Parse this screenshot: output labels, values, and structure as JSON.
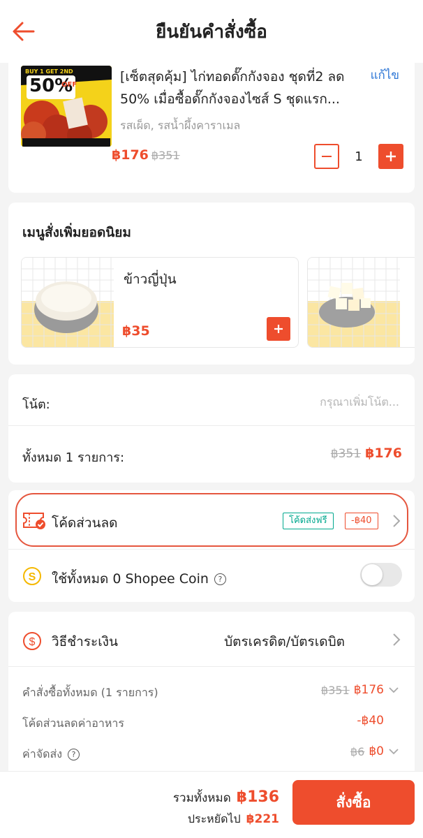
{
  "header": {
    "title": "ยืนยันคำสั่งซื้อ",
    "back_icon": "arrow-left-icon"
  },
  "product": {
    "title": "[เซ็ตสุดคุ้ม] ไก่ทอดดั๊กกังจอง ชุดที่2 ลด 50% เมื่อซื้อดั๊กกังจองไซส์ S ชุดแรก...",
    "edit_label": "แก้ไข",
    "variant": "รสเผ็ด, รสน้ำผึ้งคาราเมล",
    "price": "฿176",
    "original_price": "฿351",
    "quantity": "1",
    "image_badge": {
      "line1": "BUY 1 GET 2ND",
      "line2": "50%",
      "line3": "OFF"
    }
  },
  "popular": {
    "title": "เมนูสั่งเพิ่มยอดนิยม",
    "items": [
      {
        "name": "ข้าวญี่ปุ่น",
        "price": "฿35"
      }
    ]
  },
  "note": {
    "label": "โน้ต:",
    "placeholder": "กรุณาเพิ่มโน้ต..."
  },
  "subtotal": {
    "label": "ทั้งหมด 1 รายการ:",
    "original": "฿351",
    "total": "฿176"
  },
  "voucher": {
    "label": "โค้ดส่วนลด",
    "free_shipping_tag": "โค้ดส่งฟรี",
    "discount_tag": "-฿40"
  },
  "coin": {
    "label": "ใช้ทั้งหมด 0 Shopee Coin",
    "enabled": false
  },
  "payment": {
    "label": "วิธีชำระเงิน",
    "value": "บัตรเครดิต/บัตรเดบิต"
  },
  "summary": {
    "order_label": "คำสั่งซื้อทั้งหมด (1 รายการ)",
    "order_original": "฿351",
    "order_total": "฿176",
    "discount_label": "โค้ดส่วนลดค่าอาหาร",
    "discount_value": "-฿40",
    "shipping_label": "ค่าจัดส่ง",
    "shipping_original": "฿6",
    "shipping_value": "฿0"
  },
  "footer": {
    "total_label": "รวมทั้งหมด",
    "total_amount": "฿136",
    "saved_label": "ประหยัดไป",
    "saved_amount": "฿221",
    "order_button": "สั่งซื้อ"
  },
  "colors": {
    "accent": "#ee4d2d",
    "link": "#2e77d6",
    "free_shipping": "#00a88e",
    "coin": "#f5b800"
  }
}
